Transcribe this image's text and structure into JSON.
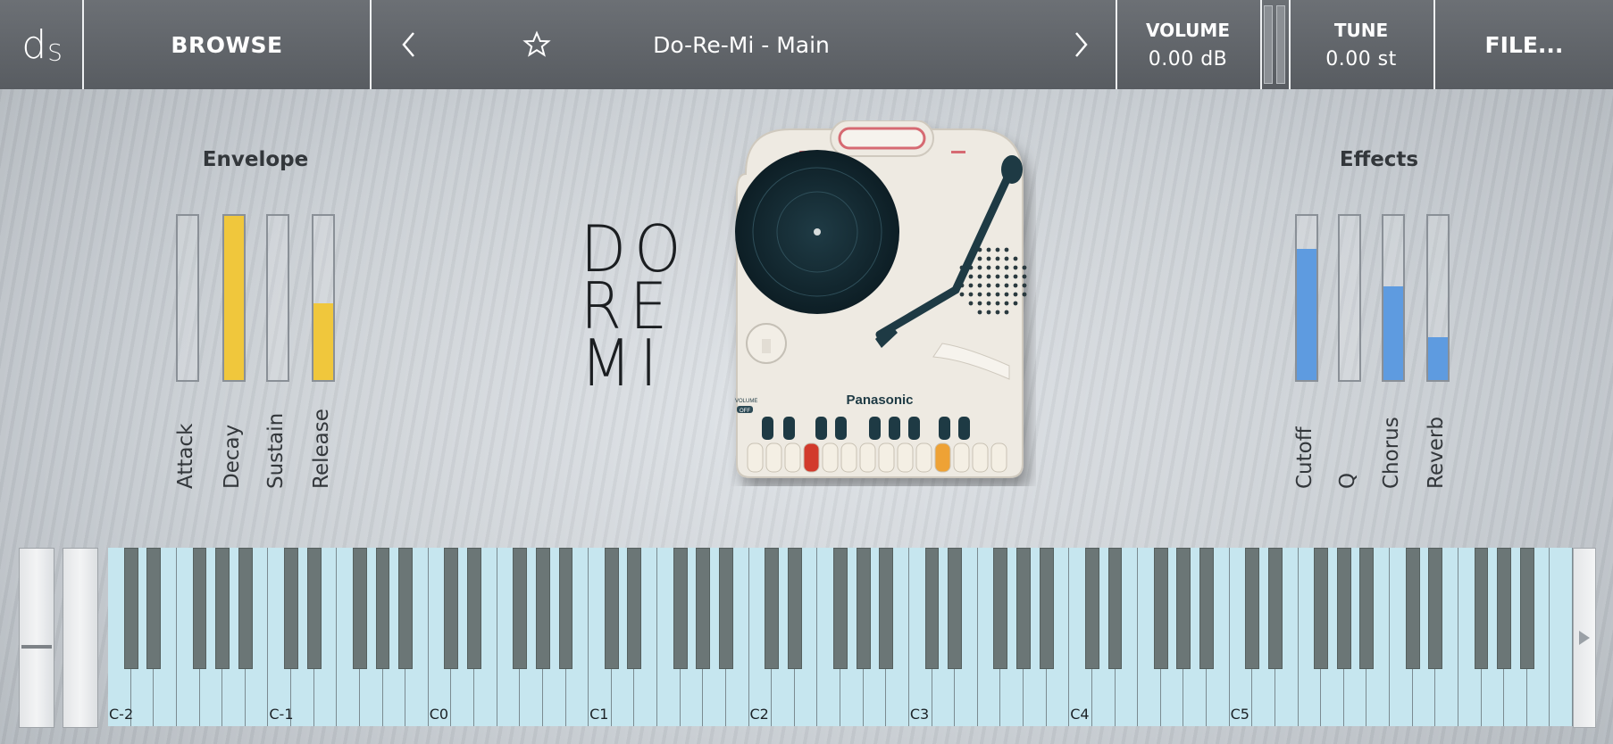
{
  "topbar": {
    "logo_d": "d",
    "logo_s": "S",
    "browse": "BROWSE",
    "prev_icon": "chevron-left-icon",
    "favorite_icon": "star-icon",
    "preset": "Do-Re-Mi - Main",
    "next_icon": "chevron-right-icon",
    "volume_label": "VOLUME",
    "volume_value": "0.00 dB",
    "tune_label": "TUNE",
    "tune_value": "0.00 st",
    "file": "FILE..."
  },
  "envelope": {
    "title": "Envelope",
    "color": "#f0c73c",
    "sliders": [
      {
        "label": "Attack",
        "level": 0.0
      },
      {
        "label": "Decay",
        "level": 1.0
      },
      {
        "label": "Sustain",
        "level": 0.0
      },
      {
        "label": "Release",
        "level": 0.47
      }
    ]
  },
  "effects": {
    "title": "Effects",
    "color": "#5e9be0",
    "sliders": [
      {
        "label": "Cutoff",
        "level": 0.8
      },
      {
        "label": "Q",
        "level": 0.0
      },
      {
        "label": "Chorus",
        "level": 0.57
      },
      {
        "label": "Reverb",
        "level": 0.26
      }
    ]
  },
  "logo_text": [
    "DO",
    "RE",
    "MI"
  ],
  "device": {
    "brand": "Panasonic",
    "volume_text": "VOLUME",
    "off_text": "OFF"
  },
  "keyboard": {
    "octave_labels": [
      "C-2",
      "C-1",
      "C0",
      "C1",
      "C2",
      "C3",
      "C4",
      "C5"
    ],
    "white_key_color": "#c6e6ef",
    "black_key_color": "#6b7676"
  }
}
